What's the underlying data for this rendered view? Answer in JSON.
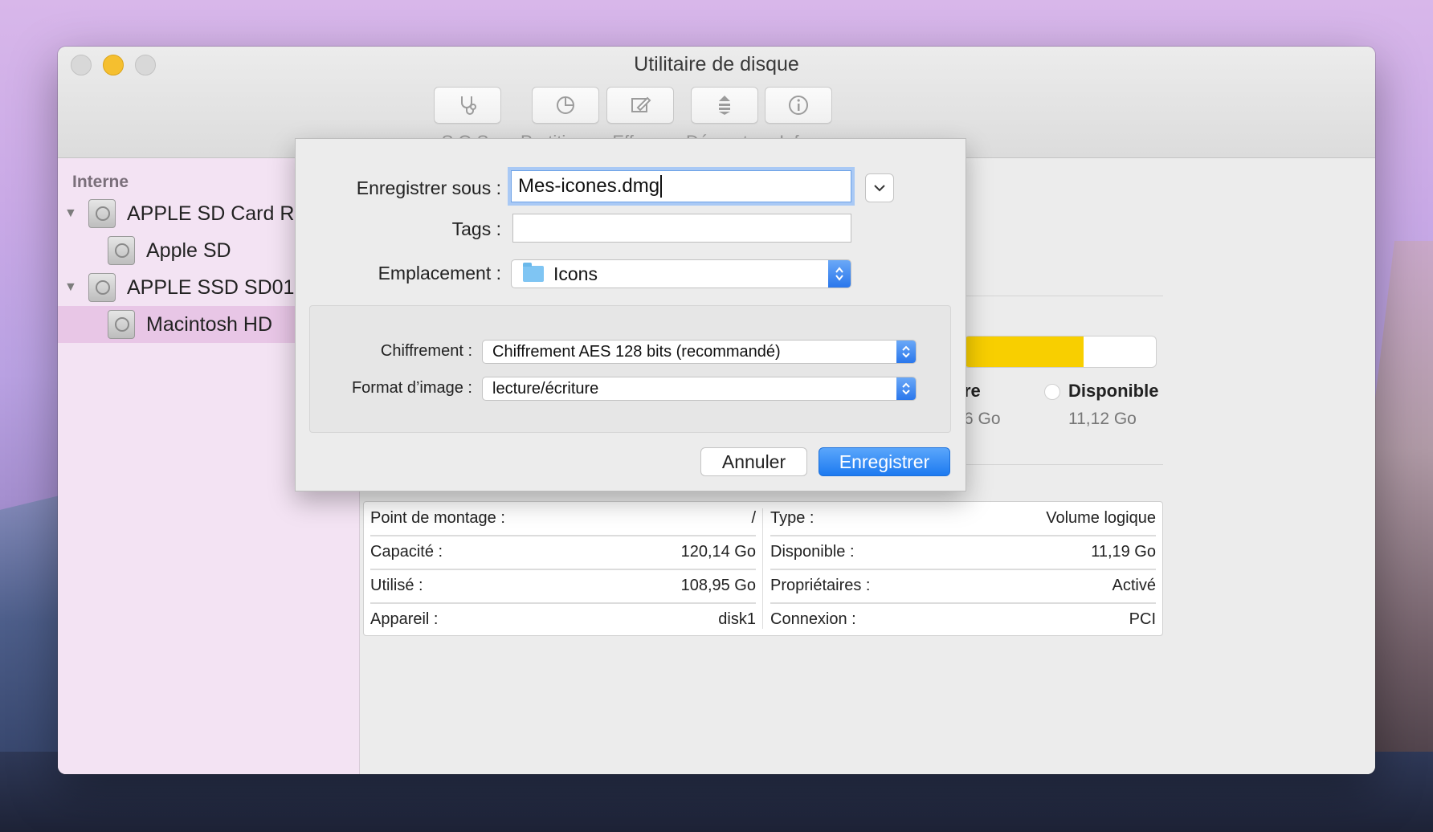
{
  "window": {
    "title": "Utilitaire de disque"
  },
  "toolbar": {
    "items": [
      {
        "label": "S.O.S.",
        "icon": "stethoscope-icon"
      },
      {
        "label": "Partitionner",
        "icon": "pie-icon"
      },
      {
        "label": "Effacer",
        "icon": "erase-icon"
      },
      {
        "label": "Démonter",
        "icon": "unmount-icon"
      },
      {
        "label": "Infos",
        "icon": "info-icon"
      }
    ]
  },
  "sidebar": {
    "section": "Interne",
    "items": [
      {
        "label": "APPLE SD Card R...",
        "level": 0
      },
      {
        "label": "Apple SD",
        "level": 1
      },
      {
        "label": "APPLE SSD SD01...",
        "level": 0
      },
      {
        "label": "Macintosh HD",
        "level": 1,
        "selected": true
      }
    ]
  },
  "main": {
    "partial_label": "re",
    "partial_value": "6 Go",
    "available_label": "Disponible",
    "available_value": "11,12 Go",
    "used_fraction": 0.62,
    "used_color": "#f8cf00",
    "info_left": [
      {
        "label": "Point de montage :",
        "value": "/"
      },
      {
        "label": "Capacité :",
        "value": "120,14 Go"
      },
      {
        "label": "Utilisé :",
        "value": "108,95 Go"
      },
      {
        "label": "Appareil :",
        "value": "disk1"
      }
    ],
    "info_right": [
      {
        "label": "Type :",
        "value": "Volume logique"
      },
      {
        "label": "Disponible :",
        "value": "11,19 Go"
      },
      {
        "label": "Propriétaires :",
        "value": "Activé"
      },
      {
        "label": "Connexion :",
        "value": "PCI"
      }
    ]
  },
  "dialog": {
    "save_as_label": "Enregistrer sous :",
    "save_as_value": "Mes-icones.dmg",
    "tags_label": "Tags :",
    "tags_value": "",
    "location_label": "Emplacement :",
    "location_value": "Icons",
    "encryption_label": "Chiffrement :",
    "encryption_value": "Chiffrement AES 128 bits (recommandé)",
    "format_label": "Format d’image :",
    "format_value": "lecture/écriture",
    "cancel_label": "Annuler",
    "save_label": "Enregistrer",
    "accent_color": "#1d7af0"
  }
}
